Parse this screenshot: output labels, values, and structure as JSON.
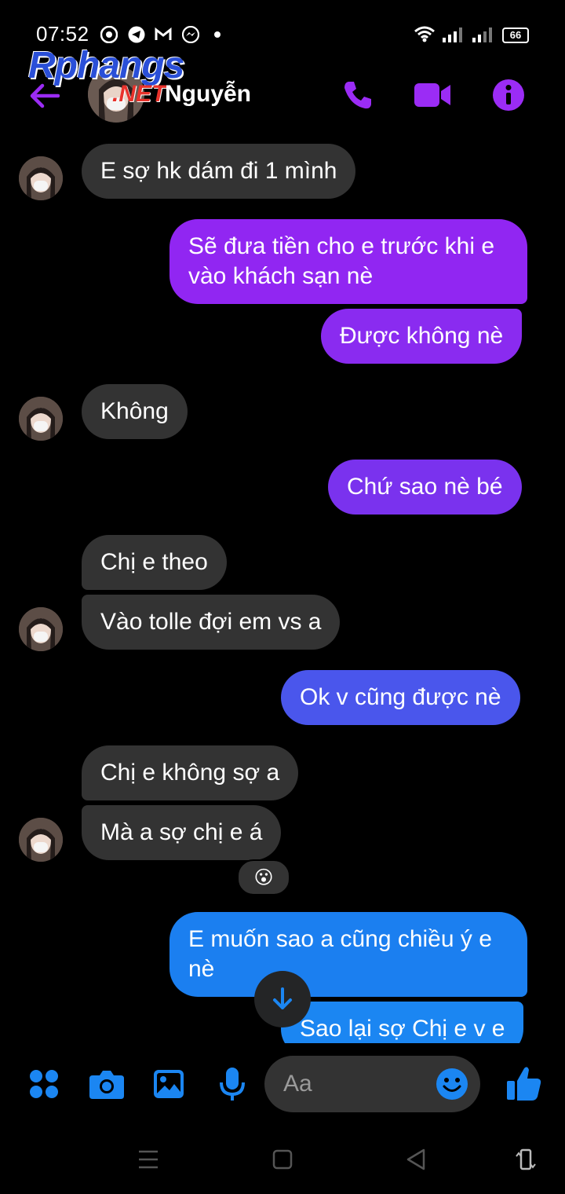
{
  "status_bar": {
    "time": "07:52",
    "battery": "66"
  },
  "header": {
    "logo_text": "Rphangs",
    "logo_suffix": ".NET",
    "contact_name": "Nguyễn"
  },
  "messages": [
    {
      "side": "in",
      "text": "E sợ hk dám đi 1 mình"
    },
    {
      "side": "out",
      "text": "Sẽ đưa tiền cho e trước khi e vào khách sạn nè"
    },
    {
      "side": "out",
      "text": "Được không nè"
    },
    {
      "side": "in",
      "text": "Không"
    },
    {
      "side": "out",
      "text": "Chứ sao nè bé"
    },
    {
      "side": "in",
      "text": "Chị e theo"
    },
    {
      "side": "in",
      "text": "Vào tolle đợi em vs a"
    },
    {
      "side": "out",
      "text": "Ok v cũng được nè"
    },
    {
      "side": "in",
      "text": "Chị e không sợ a"
    },
    {
      "side": "in",
      "text": "Mà a sợ chị e á"
    },
    {
      "side": "out",
      "text": "E muốn sao a cũng chiều ý e nè"
    },
    {
      "side": "out",
      "text": "Sao lại sợ Chị e v e"
    }
  ],
  "reaction": "😮",
  "composer": {
    "placeholder": "Aa"
  },
  "colors": {
    "accent": "#9b2cf5",
    "incoming": "#333333",
    "blue": "#1b86f2"
  }
}
